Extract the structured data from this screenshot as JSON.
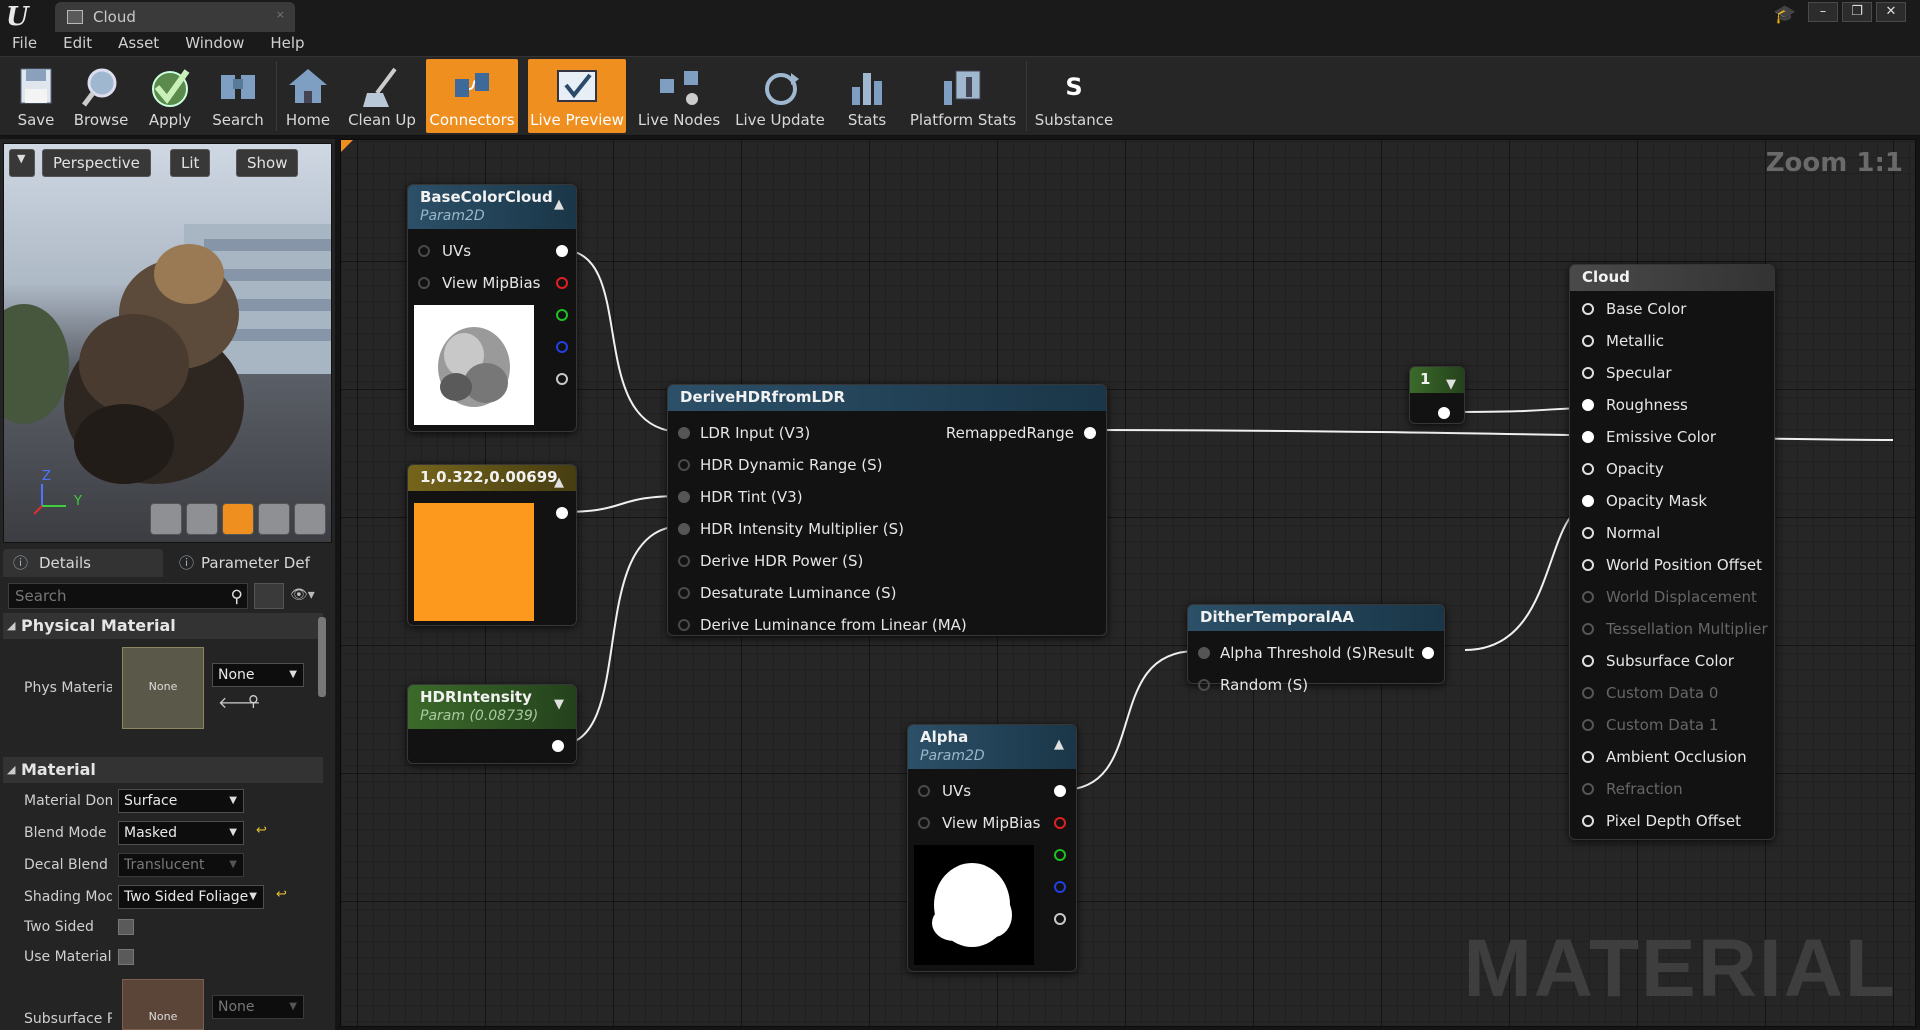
{
  "window": {
    "tab_title": "Cloud",
    "tab_close": "×",
    "controls": [
      "–",
      "❐",
      "✕"
    ]
  },
  "menu": [
    "File",
    "Edit",
    "Asset",
    "Window",
    "Help"
  ],
  "toolbar": [
    {
      "label": "Save",
      "icon": "save-icon"
    },
    {
      "label": "Browse",
      "icon": "browse-icon"
    },
    {
      "label": "Apply",
      "icon": "apply-icon"
    },
    {
      "label": "Search",
      "icon": "search-icon"
    },
    {
      "label": "Home",
      "icon": "home-icon"
    },
    {
      "label": "Clean Up",
      "icon": "clean-up-icon"
    },
    {
      "label": "Connectors",
      "icon": "connectors-icon",
      "active": true
    },
    {
      "label": "Live Preview",
      "icon": "live-preview-icon",
      "active": true
    },
    {
      "label": "Live Nodes",
      "icon": "live-nodes-icon"
    },
    {
      "label": "Live Update",
      "icon": "live-update-icon"
    },
    {
      "label": "Stats",
      "icon": "stats-icon"
    },
    {
      "label": "Platform Stats",
      "icon": "platform-stats-icon"
    },
    {
      "label": "Substance",
      "icon": "substance-icon"
    }
  ],
  "viewport": {
    "perspective": "Perspective",
    "lit": "Lit",
    "show": "Show",
    "axis_z": "Z",
    "axis_y": "Y"
  },
  "details": {
    "tabs": [
      "Details",
      "Parameter Def"
    ],
    "search_placeholder": "Search",
    "physical_material_header": "Physical Material",
    "phys_material_label": "Phys Materia",
    "phys_thumb": "None",
    "phys_value": "None",
    "material_header": "Material",
    "props": [
      {
        "label": "Material Dom",
        "value": "Surface"
      },
      {
        "label": "Blend Mode",
        "value": "Masked"
      },
      {
        "label": "Decal Blend I",
        "value": "Translucent"
      },
      {
        "label": "Shading Mod",
        "value": "Two Sided Foliage"
      },
      {
        "label": "Two Sided",
        "value": ""
      },
      {
        "label": "Use Material",
        "value": ""
      },
      {
        "label": "Subsurface P",
        "value": "None"
      }
    ],
    "subsurface_thumb": "None"
  },
  "graph": {
    "zoom": "Zoom 1:1",
    "watermark": "MATERIAL",
    "nodes": {
      "basecolorcloud": {
        "title": "BaseColorCloud",
        "sub": "Param2D",
        "pins": [
          "UVs",
          "View MipBias"
        ]
      },
      "constant3": {
        "title": "1,0.322,0.00699",
        "color": "#fd9a1e"
      },
      "hdrintensity": {
        "title": "HDRIntensity",
        "sub": "Param (0.08739)"
      },
      "derive": {
        "title": "DeriveHDRfromLDR",
        "inputs": [
          "LDR Input (V3)",
          "HDR Dynamic Range (S)",
          "HDR Tint (V3)",
          "HDR Intensity Multiplier (S)",
          "Derive HDR Power (S)",
          "Desaturate Luminance (S)",
          "Derive Luminance from Linear (MA)"
        ],
        "output": "RemappedRange"
      },
      "alpha": {
        "title": "Alpha",
        "sub": "Param2D",
        "pins": [
          "UVs",
          "View MipBias"
        ]
      },
      "dither": {
        "title": "DitherTemporalAA",
        "inputs": [
          "Alpha Threshold (S)",
          "Random (S)"
        ],
        "output": "Result"
      },
      "constant1": {
        "title": "1"
      },
      "cloud": {
        "title": "Cloud",
        "inputs": [
          {
            "label": "Base Color",
            "enabled": true
          },
          {
            "label": "Metallic",
            "enabled": true
          },
          {
            "label": "Specular",
            "enabled": true
          },
          {
            "label": "Roughness",
            "enabled": true,
            "connected": true
          },
          {
            "label": "Emissive Color",
            "enabled": true,
            "connected": true
          },
          {
            "label": "Opacity",
            "enabled": true
          },
          {
            "label": "Opacity Mask",
            "enabled": true,
            "connected": true
          },
          {
            "label": "Normal",
            "enabled": true
          },
          {
            "label": "World Position Offset",
            "enabled": true
          },
          {
            "label": "World Displacement",
            "enabled": false
          },
          {
            "label": "Tessellation Multiplier",
            "enabled": false
          },
          {
            "label": "Subsurface Color",
            "enabled": true
          },
          {
            "label": "Custom Data 0",
            "enabled": false
          },
          {
            "label": "Custom Data 1",
            "enabled": false
          },
          {
            "label": "Ambient Occlusion",
            "enabled": true
          },
          {
            "label": "Refraction",
            "enabled": false
          },
          {
            "label": "Pixel Depth Offset",
            "enabled": true
          }
        ]
      }
    }
  }
}
